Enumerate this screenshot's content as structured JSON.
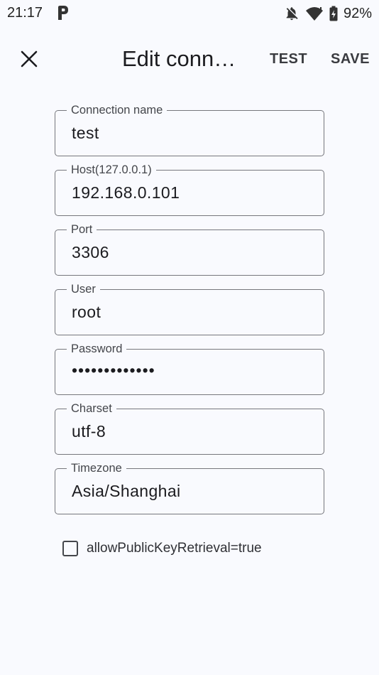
{
  "status_bar": {
    "time": "21:17",
    "battery_percent": "92%",
    "icons": [
      "parking-p-icon",
      "notifications-off-icon",
      "wifi-icon",
      "battery-charging-icon"
    ]
  },
  "app_bar": {
    "title": "Edit conne…",
    "test_label": "TEST",
    "save_label": "SAVE",
    "close_icon": "close-icon"
  },
  "form": {
    "connection_name": {
      "label": "Connection name",
      "value": "test"
    },
    "host": {
      "label": "Host(127.0.0.1)",
      "value": "192.168.0.101"
    },
    "port": {
      "label": "Port",
      "value": "3306"
    },
    "user": {
      "label": "User",
      "value": "root"
    },
    "password": {
      "label": "Password",
      "value": "•••••••••••••"
    },
    "charset": {
      "label": "Charset",
      "value": "utf-8"
    },
    "timezone": {
      "label": "Timezone",
      "value": "Asia/Shanghai"
    }
  },
  "options": {
    "allow_public_key_retrieval": {
      "label": "allowPublicKeyRetrieval=true",
      "checked": false
    }
  },
  "colors": {
    "background": "#f9fafe",
    "outline": "#76777c",
    "text": "#1b1b1f"
  }
}
